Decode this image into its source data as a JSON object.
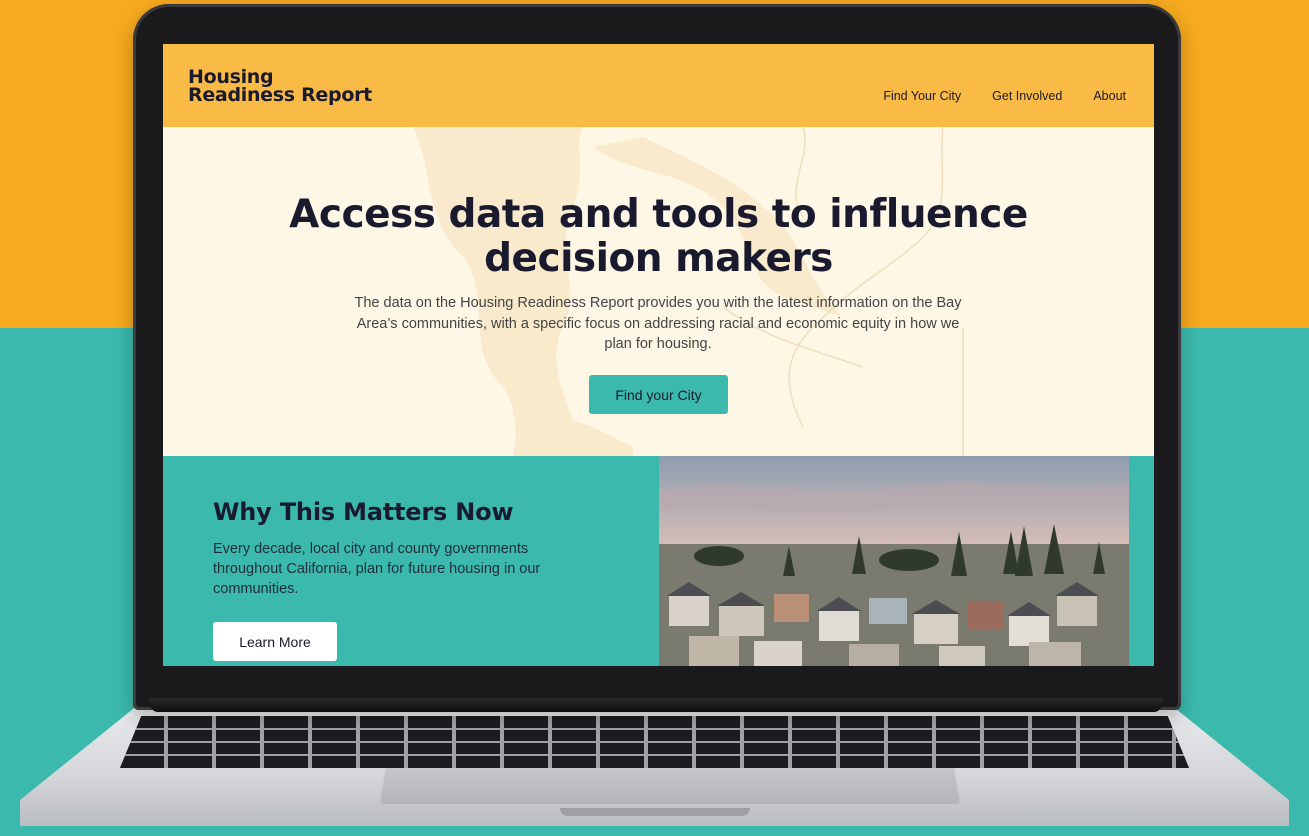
{
  "site": {
    "logo": {
      "line1": "Housing",
      "line2": "Readiness Report"
    },
    "nav": [
      {
        "label": "Find Your City"
      },
      {
        "label": "Get Involved"
      },
      {
        "label": "About"
      }
    ]
  },
  "hero": {
    "title_line1": "Access data and tools to influence",
    "title_line2": "decision makers",
    "description": "The data on the Housing Readiness Report provides you with the latest information on the Bay Area’s communities, with a specific focus on addressing racial and economic equity in how we plan for housing.",
    "cta_label": "Find your City"
  },
  "why_section": {
    "title": "Why This Matters Now",
    "body": "Every decade, local city and county governments throughout California, plan for future housing in our communities.",
    "button_label": "Learn More"
  },
  "colors": {
    "background_orange": "#F7AA1E",
    "background_teal": "#3BB9AD",
    "header_yellow": "#F9BB45",
    "hero_cream": "#FEF7E6",
    "text_dark": "#1a1a2e"
  }
}
